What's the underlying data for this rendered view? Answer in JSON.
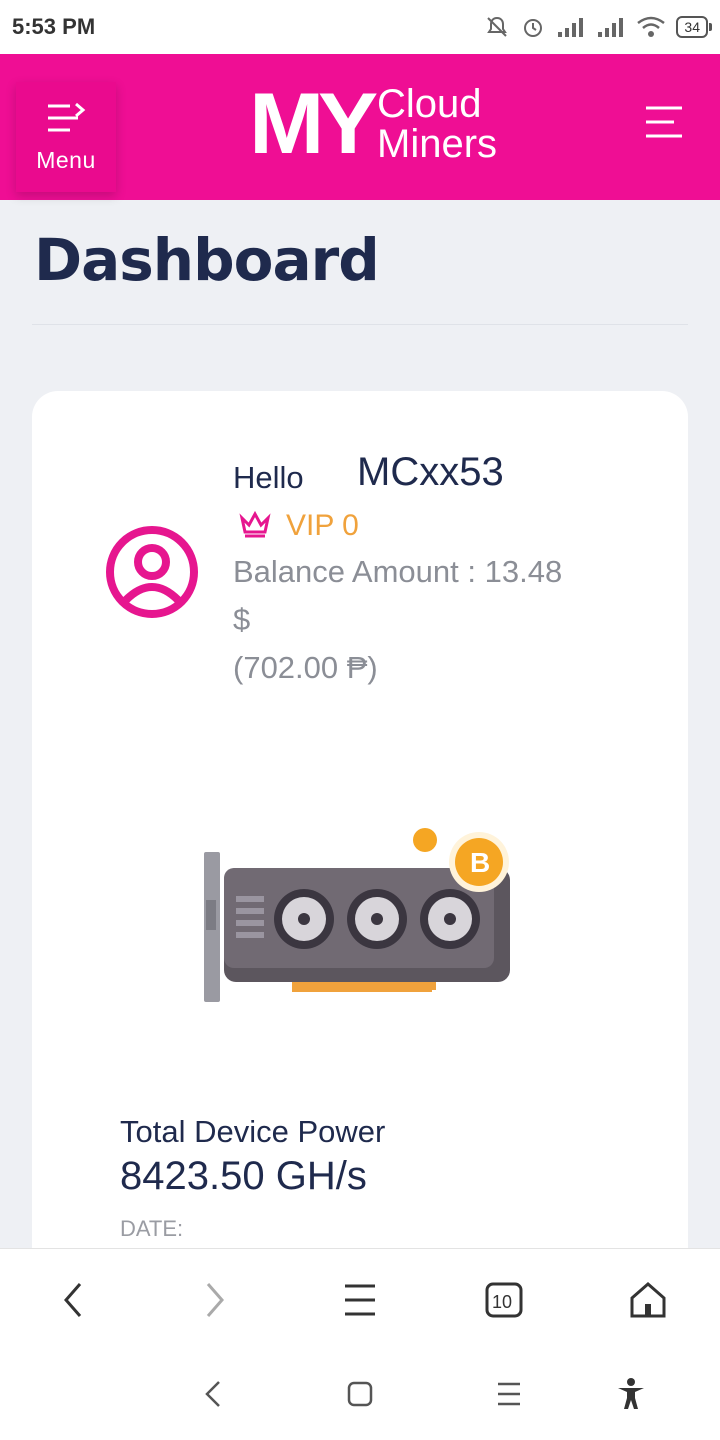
{
  "status_bar": {
    "time": "5:53 PM",
    "battery": "34"
  },
  "header": {
    "menu_label": "Menu",
    "logo": {
      "my": "MY",
      "line1": "Cloud",
      "line2": "Miners"
    },
    "brand_color": "#ef0e94"
  },
  "page": {
    "title": "Dashboard"
  },
  "profile": {
    "hello": "Hello",
    "username": "MCxx53",
    "vip": "VIP 0",
    "balance_line1": "Balance Amount : 13.48",
    "balance_line2": "$",
    "balance_line3": "(702.00 ₱)"
  },
  "device": {
    "power_label": "Total Device Power",
    "power_value": "8423.50 GH/s",
    "date_label": "DATE:"
  },
  "browser": {
    "tab_count": "10"
  },
  "colors": {
    "accent": "#ef0e94",
    "vip": "#f0a23c",
    "heading": "#1f2a4d"
  }
}
